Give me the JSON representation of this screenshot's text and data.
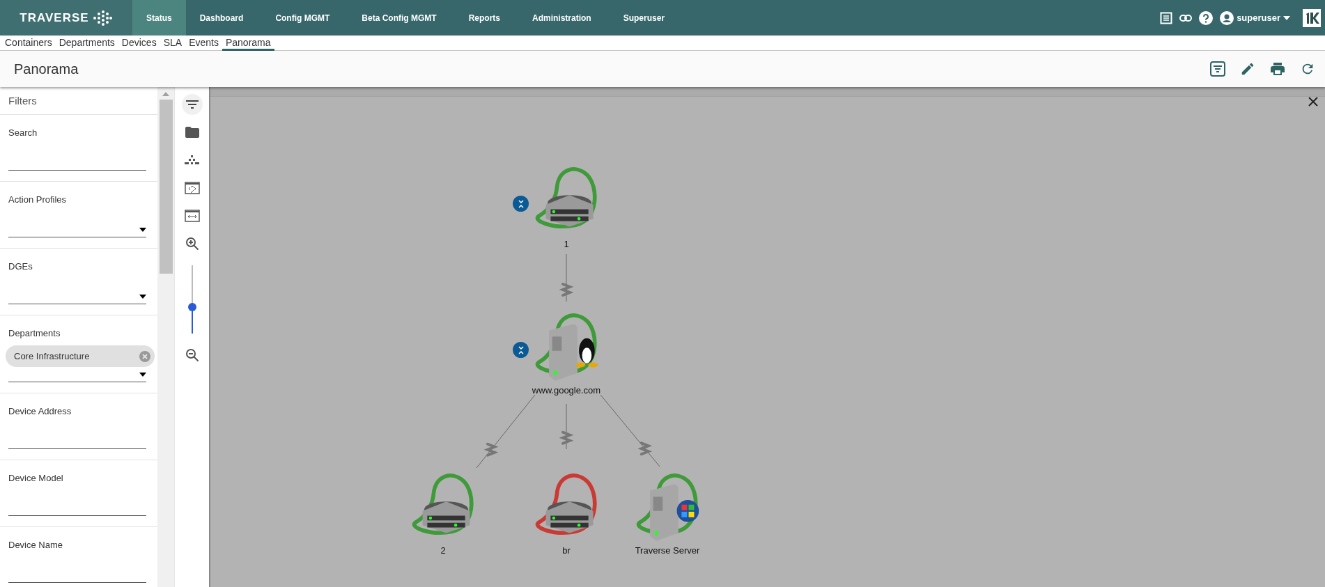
{
  "top_nav": {
    "logo": "TRAVERSE",
    "items": [
      {
        "label": "Status",
        "selected": true
      },
      {
        "label": "Dashboard",
        "selected": false
      },
      {
        "label": "Config MGMT",
        "selected": false
      },
      {
        "label": "Beta Config MGMT",
        "selected": false
      },
      {
        "label": "Reports",
        "selected": false
      },
      {
        "label": "Administration",
        "selected": false
      },
      {
        "label": "Superuser",
        "selected": false
      }
    ],
    "user": "superuser"
  },
  "sub_nav": [
    {
      "label": "Containers",
      "selected": false
    },
    {
      "label": "Departments",
      "selected": false
    },
    {
      "label": "Devices",
      "selected": false
    },
    {
      "label": "SLA",
      "selected": false
    },
    {
      "label": "Events",
      "selected": false
    },
    {
      "label": "Panorama",
      "selected": true
    }
  ],
  "page": {
    "title": "Panorama"
  },
  "filters": {
    "title": "Filters",
    "fields": [
      {
        "label": "Search",
        "kind": "text"
      },
      {
        "label": "Action Profiles",
        "kind": "select"
      },
      {
        "label": "DGEs",
        "kind": "select"
      },
      {
        "label": "Departments",
        "kind": "select",
        "chips": [
          "Core Infrastructure"
        ]
      },
      {
        "label": "Device Address",
        "kind": "text"
      },
      {
        "label": "Device Model",
        "kind": "text"
      },
      {
        "label": "Device Name",
        "kind": "text"
      }
    ]
  },
  "zoom": {
    "level": 0.39
  },
  "nodes": [
    {
      "label": "1",
      "kind": "router",
      "color": "#3f9a3a",
      "collapsible": true
    },
    {
      "label": "www.google.com",
      "kind": "linux-server",
      "color": "#3f9a3a",
      "collapsible": true
    },
    {
      "label": "2",
      "kind": "router",
      "color": "#3f9a3a",
      "collapsible": false
    },
    {
      "label": "br",
      "kind": "router",
      "color": "#c93a35",
      "collapsible": false
    },
    {
      "label": "Traverse Server",
      "kind": "windows-server",
      "color": "#3f9a3a",
      "collapsible": false
    }
  ]
}
